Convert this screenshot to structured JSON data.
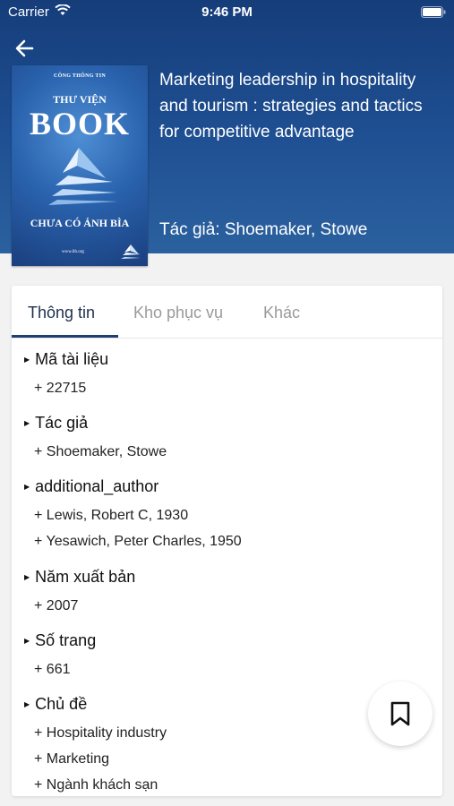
{
  "status": {
    "carrier": "Carrier",
    "time": "9:46 PM"
  },
  "book": {
    "title": "Marketing leadership in hospitality and tourism : strategies and tactics for competitive advantage",
    "author_line": "Tác giả: Shoemaker, Stowe",
    "cover": {
      "publisher": "CÔNG THÔNG TIN",
      "line1": "THƯ VIỆN",
      "line2": "BOOK",
      "line3": "CHƯA CÓ ẢNH BÌA",
      "url": "www.lib.org"
    }
  },
  "tabs": [
    "Thông tin",
    "Kho phục vụ",
    "Khác"
  ],
  "sections": [
    {
      "label": "Mã tài liệu",
      "values": [
        "+ 22715"
      ]
    },
    {
      "label": "Tác giả",
      "values": [
        "+ Shoemaker, Stowe"
      ]
    },
    {
      "label": "additional_author",
      "values": [
        "+ Lewis, Robert C, 1930",
        "+ Yesawich, Peter Charles, 1950"
      ]
    },
    {
      "label": "Năm xuất bản",
      "values": [
        "+ 2007"
      ]
    },
    {
      "label": "Số trang",
      "values": [
        "+ 661"
      ]
    },
    {
      "label": "Chủ đề",
      "values": [
        "+ Hospitality industry",
        "+ Marketing",
        "+ Ngành khách sạn"
      ]
    }
  ],
  "icons": {
    "back": "arrow-left-icon",
    "bookmark": "bookmark-icon",
    "wifi": "wifi-icon",
    "battery": "battery-icon"
  },
  "colors": {
    "header": "#1f5093",
    "accent": "#1f3f72"
  }
}
